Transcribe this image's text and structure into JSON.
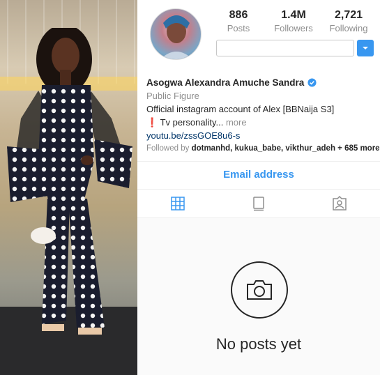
{
  "profile": {
    "stats": {
      "posts": {
        "value": "886",
        "label": "Posts"
      },
      "followers": {
        "value": "1.4M",
        "label": "Followers"
      },
      "following": {
        "value": "2,721",
        "label": "Following"
      }
    },
    "name": "Asogwa Alexandra Amuche Sandra",
    "category": "Public Figure",
    "bio_line1": "Official instagram account of Alex [BBNaija S3]",
    "bio_line2": "❗ Tv personality...",
    "bio_more": " more",
    "link": "youtu.be/zssGOE8u6-s",
    "followed_prefix": "Followed by ",
    "followed_names": "dotmanhd, kukua_babe, vikthur_adeh",
    "followed_suffix": " + 685 more",
    "email_button": "Email address",
    "empty_state": "No posts yet"
  },
  "icons": {
    "verified": "verified-badge-icon",
    "dropdown": "chevron-down-icon",
    "grid_tab": "grid-icon",
    "feed_tab": "feed-icon",
    "tagged_tab": "tagged-icon",
    "camera": "camera-icon"
  },
  "colors": {
    "accent": "#3897f0",
    "link": "#003569",
    "muted": "#8e8e8e"
  }
}
